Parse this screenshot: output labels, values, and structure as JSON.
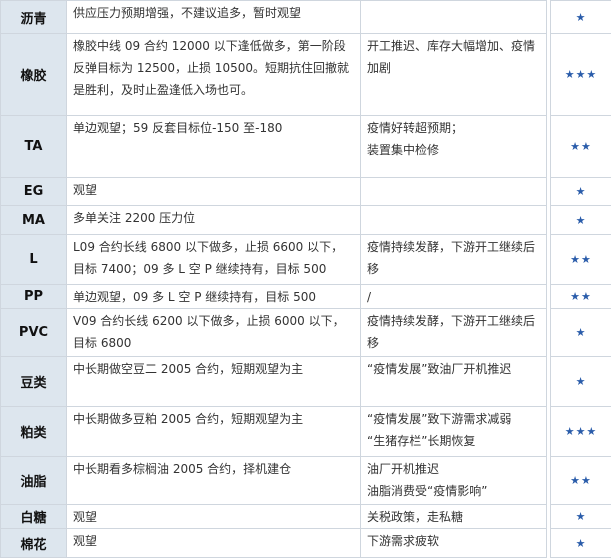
{
  "rows": [
    {
      "name": "沥青",
      "strategy": "供应压力预期增强，不建议追多，暂时观望",
      "reasons": [],
      "stars": "★"
    },
    {
      "name": "橡胶",
      "strategy": "橡胶中线 09 合约 12000 以下逢低做多，第一阶段反弹目标为 12500，止损 10500。短期抗住回撤就是胜利，及时止盈逢低入场也可。",
      "reasons": [
        "开工推迟、库存大幅增加、疫情加剧"
      ],
      "stars": "★★★"
    },
    {
      "name": "TA",
      "strategy": "单边观望；59 反套目标位-150 至-180",
      "reasons": [
        "疫情好转超预期；",
        "装置集中检修"
      ],
      "stars": "★★"
    },
    {
      "name": "EG",
      "strategy": "观望",
      "reasons": [],
      "stars": "★"
    },
    {
      "name": "MA",
      "strategy": "多单关注 2200 压力位",
      "reasons": [],
      "stars": "★"
    },
    {
      "name": "L",
      "strategy": "L09 合约长线 6800 以下做多，止损 6600 以下，目标 7400；09 多 L 空 P 继续持有，目标 500",
      "reasons": [
        "疫情持续发酵，下游开工继续后移"
      ],
      "stars": "★★"
    },
    {
      "name": "PP",
      "strategy": "单边观望，09 多 L 空 P 继续持有，目标 500",
      "reasons": [
        "/"
      ],
      "stars": "★★"
    },
    {
      "name": "PVC",
      "strategy": "V09 合约长线 6200 以下做多，止损 6000 以下，目标 6800",
      "reasons": [
        "疫情持续发酵，下游开工继续后移"
      ],
      "stars": "★"
    },
    {
      "name": "豆类",
      "strategy": "中长期做空豆二 2005 合约，短期观望为主",
      "reasons": [
        "“疫情发展”致油厂开机推迟"
      ],
      "stars": "★"
    },
    {
      "name": "粕类",
      "strategy": "中长期做多豆粕 2005 合约，短期观望为主",
      "reasons": [
        "“疫情发展”致下游需求减弱",
        "“生猪存栏”长期恢复"
      ],
      "stars": "★★★"
    },
    {
      "name": "油脂",
      "strategy": "中长期看多棕榈油 2005 合约，择机建仓",
      "reasons": [
        "油厂开机推迟",
        "油脂消费受“疫情影响”"
      ],
      "stars": "★★"
    },
    {
      "name": "白糖",
      "strategy": "观望",
      "reasons": [
        "关税政策，走私糖"
      ],
      "stars": "★"
    },
    {
      "name": "棉花",
      "strategy": "观望",
      "reasons": [
        "下游需求疲软"
      ],
      "stars": "★"
    }
  ]
}
